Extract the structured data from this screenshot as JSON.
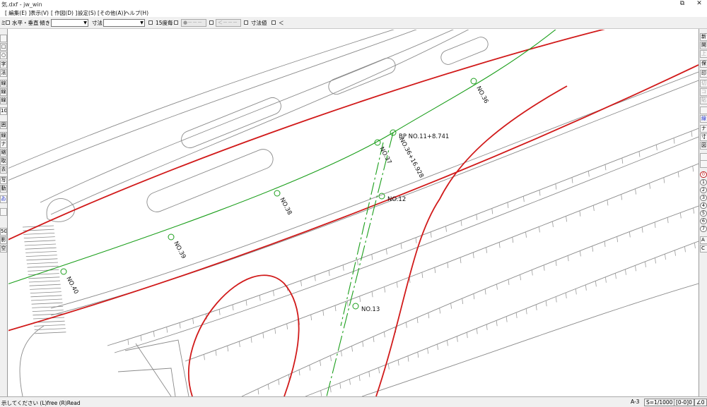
{
  "app": {
    "title": "気.dxf - jw_win"
  },
  "window_controls": {
    "restore_glyph": "⧉",
    "close_glyph": "✕"
  },
  "menu": [
    "[ 編集(E) ]",
    "表示(V)",
    "[ 作図(D) ]",
    "設定(S)",
    "[その他(A)]",
    "ヘルプ(H)"
  ],
  "toolbar": {
    "lead": "ミ",
    "horizontal_vertical": "水平・垂直",
    "slope_label": "傾き",
    "dimension_label": "寸法",
    "deg15_label": "15度毎",
    "btn_circle": "●－－－",
    "btn_arrow": "＜－－－",
    "dim_value_label": "寸法値",
    "last_label": "＜"
  },
  "left_tools": [
    "",
    "□",
    "○",
    "字",
    "法",
    "線",
    "線",
    "線",
    "10",
    "囲",
    "線",
    "ナ",
    "縮",
    "取",
    "去",
    "写",
    "動",
    "ゐ",
    "",
    "50",
    "影",
    "空"
  ],
  "right_tools": [
    "新",
    "開",
    "上",
    "保",
    "印",
    "切",
    "コ",
    "貼",
    "",
    "線",
    "ナ",
    "寸",
    "図",
    "",
    "",
    "A",
    "C"
  ],
  "layers": [
    "0",
    "1",
    "2",
    "3",
    "4",
    "5",
    "6",
    "7"
  ],
  "status": {
    "message": "示してください (L)free (R)Read",
    "paper": "A-3",
    "scale": "S=1/1000",
    "layer": "[0-0]0",
    "angle": "∠0"
  },
  "drawing": {
    "colors": {
      "road_edge": "#d11a1a",
      "centerline": "#1a9e1a",
      "base": "#8a8a8a"
    },
    "labels": {
      "no36": "NO.36",
      "no37": "NO.37",
      "no38": "NO.38",
      "no39": "NO.39",
      "no40": "NO.40",
      "bp": "BP NO.11+8.741",
      "no36_sta": "NO.36+16.928",
      "no12": "NO.12",
      "no13": "NO.13"
    }
  }
}
